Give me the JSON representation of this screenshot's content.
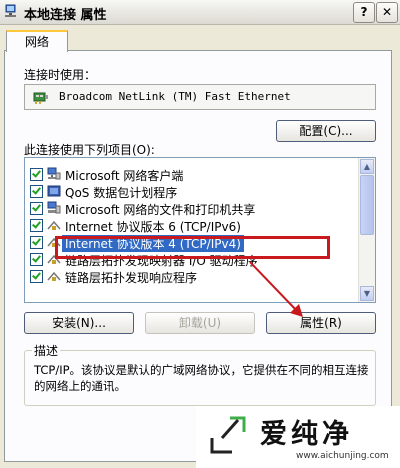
{
  "window": {
    "title": "本地连接 属性",
    "help_label": "?",
    "close_label": "✕"
  },
  "tabs": [
    {
      "label": "网络"
    }
  ],
  "connect_using": {
    "label": "连接时使用：",
    "adapter": "Broadcom NetLink (TM) Fast Ethernet",
    "configure_button": "配置(C)..."
  },
  "components": {
    "label": "此连接使用下列项目(O):",
    "items": [
      {
        "label": "Microsoft 网络客户端",
        "checked": true,
        "icon": "network-client-icon"
      },
      {
        "label": "QoS 数据包计划程序",
        "checked": true,
        "icon": "qos-icon"
      },
      {
        "label": "Microsoft 网络的文件和打印机共享",
        "checked": true,
        "icon": "file-share-icon"
      },
      {
        "label": "Internet 协议版本 6 (TCP/IPv6)",
        "checked": true,
        "icon": "protocol-icon"
      },
      {
        "label": "Internet 协议版本 4 (TCP/IPv4)",
        "checked": true,
        "icon": "protocol-icon",
        "selected": true
      },
      {
        "label": "链路层拓扑发现映射器 I/O 驱动程序",
        "checked": true,
        "icon": "protocol-icon"
      },
      {
        "label": "链路层拓扑发现响应程序",
        "checked": true,
        "icon": "protocol-icon"
      }
    ]
  },
  "buttons": {
    "install": "安装(N)...",
    "uninstall": "卸载(U)",
    "properties": "属性(R)"
  },
  "description": {
    "title": "描述",
    "text": "TCP/IP。该协议是默认的广域网络协议，它提供在不同的相互连接的网络上的通讯。"
  },
  "watermark": {
    "brand": "爱纯净",
    "url": "www.aichunjing.com"
  },
  "colors": {
    "highlight": "#c8191e",
    "selection": "#316ac5",
    "tab_accent": "#ffc83c"
  }
}
